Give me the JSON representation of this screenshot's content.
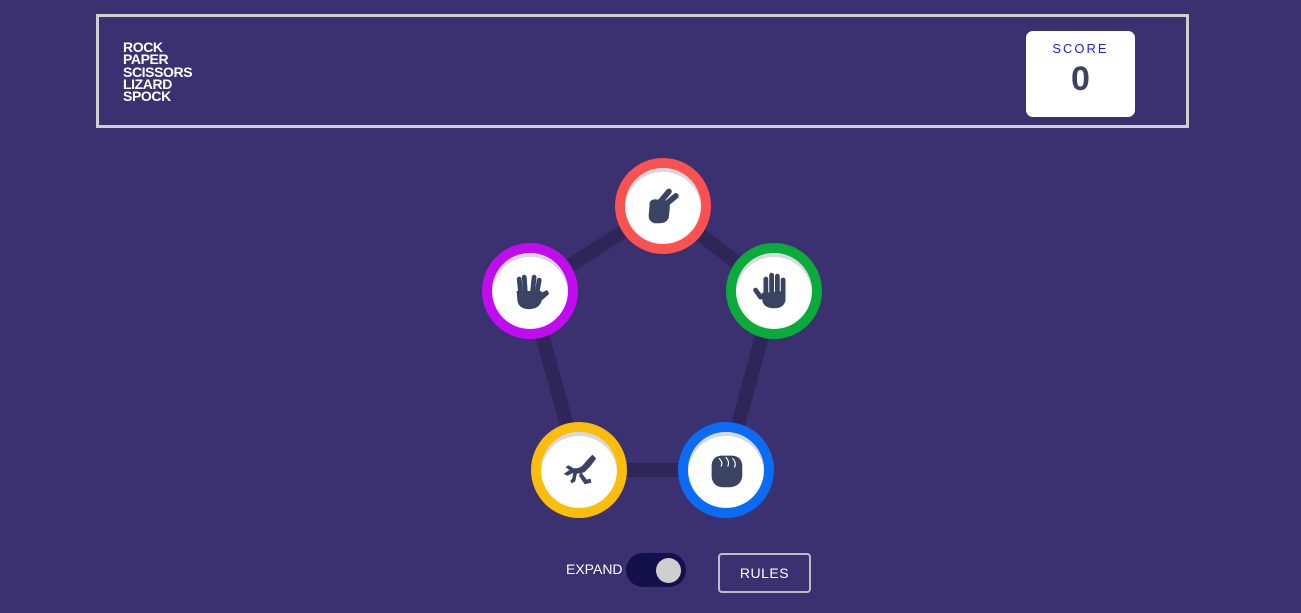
{
  "header": {
    "title_lines": [
      "ROCK",
      "PAPER",
      "SCISSORS",
      "LIZARD",
      "SPOCK"
    ],
    "score_label": "SCORE",
    "score_value": "0"
  },
  "tokens": [
    {
      "name": "scissors",
      "icon": "scissors-hand-icon",
      "color": "#fa5151"
    },
    {
      "name": "paper",
      "icon": "open-hand-icon",
      "color": "#0aab3a"
    },
    {
      "name": "rock",
      "icon": "fist-icon",
      "color": "#0a6cf5"
    },
    {
      "name": "lizard",
      "icon": "lizard-icon",
      "color": "#fbbd0b"
    },
    {
      "name": "spock",
      "icon": "vulcan-salute-icon",
      "color": "#c10cef"
    }
  ],
  "controls": {
    "expand_label": "EXPAND",
    "expand_on": true,
    "rules_label": "RULES"
  },
  "colors": {
    "background": "#3b3170",
    "line": "#2e2658",
    "icon": "#3a4363"
  }
}
